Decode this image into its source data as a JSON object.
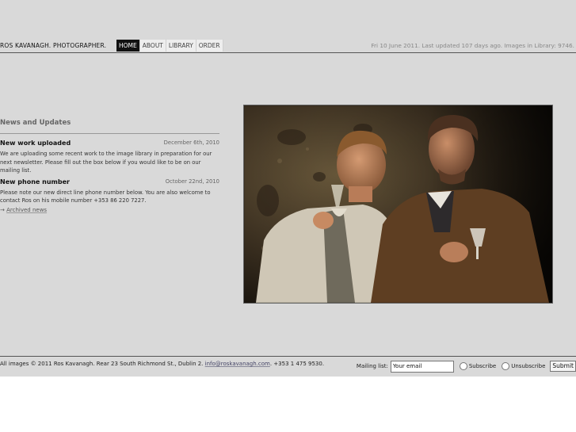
{
  "header": {
    "site_title": "ROS KAVANAGH. PHOTOGRAPHER.",
    "nav": [
      {
        "label": "HOME",
        "active": true
      },
      {
        "label": "ABOUT",
        "active": false
      },
      {
        "label": "LIBRARY",
        "active": false
      },
      {
        "label": "ORDER",
        "active": false
      }
    ],
    "status": "Fri 10 June 2011. Last updated 107 days ago. Images in Library: 9746."
  },
  "news": {
    "heading": "News and Updates",
    "items": [
      {
        "title": "New work uploaded",
        "date": "December 6th, 2010",
        "body": "We are uploading some recent work to the image library in preparation for our next newsletter. Please fill out the box below if you would like to be on our mailing list."
      },
      {
        "title": "New phone number",
        "date": "October 22nd, 2010",
        "body": "Please note our new direct line phone number below. You are also welcome to contact Ros on his mobile number +353 86 220 7227."
      }
    ],
    "archived_link": "Archived news"
  },
  "footer": {
    "copyright_prefix": "All images © 2011 Ros Kavanagh. Rear 23 South Richmond St., Dublin 2. ",
    "email": "info@roskavanagh.com",
    "phone_suffix": ". +353 1 475 9530.",
    "mailing_label": "Mailing list:",
    "email_value": "Your email",
    "subscribe_label": "Subscribe",
    "unsubscribe_label": "Unsubscribe",
    "submit_label": "Submit"
  }
}
